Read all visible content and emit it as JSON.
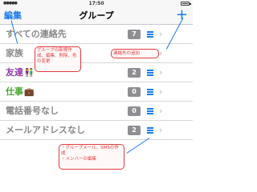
{
  "status_bar": {
    "time": "17:50"
  },
  "nav": {
    "edit_label": "編集",
    "title": "グループ",
    "add_label": "+"
  },
  "rows": [
    {
      "label": "すべての連絡先",
      "count": "7",
      "emoji": ""
    },
    {
      "label": "家族",
      "count": "",
      "emoji": ""
    },
    {
      "label": "友達",
      "count": "2",
      "emoji": "👫"
    },
    {
      "label": "仕事",
      "count": "0",
      "emoji": "💼"
    },
    {
      "label": "電話番号なし",
      "count": "0",
      "emoji": ""
    },
    {
      "label": "メールアドレスなし",
      "count": "2",
      "emoji": ""
    }
  ],
  "annotations": {
    "edit_note": "グループの新規作成、編集、削除、色の変更",
    "add_note": "連絡先の追加",
    "menu_note_1": "・グループメール、SMSの作成",
    "menu_note_2": "・メンバーの編集"
  },
  "colors": {
    "accent": "#1a7ae8",
    "annotation": "#e23c3c",
    "badge": "#8e8e93"
  },
  "icons": {
    "row_menu": "hamburger-list-icon",
    "row_disclosure": "chevron-right-icon",
    "add": "plus-icon"
  }
}
